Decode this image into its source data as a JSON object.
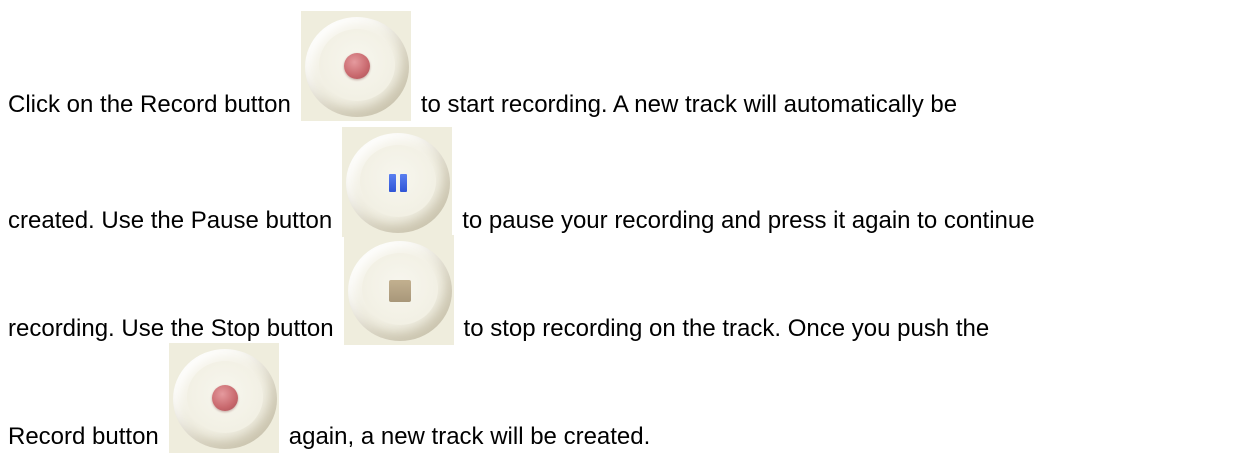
{
  "lines": [
    {
      "before": "Click on the Record button",
      "icon": "record-icon",
      "after": "to start recording. A new track will automatically be"
    },
    {
      "before": "created. Use the Pause button",
      "icon": "pause-icon",
      "after": "to pause your recording and press it again to continue"
    },
    {
      "before": "recording. Use the Stop button",
      "icon": "stop-icon",
      "after": " to stop recording on the track.  Once you push the"
    },
    {
      "before": "Record button",
      "icon": "record-icon",
      "after": "again, a new track will be created."
    }
  ],
  "colors": {
    "record": "#c8686d",
    "pause": "#2f55d6",
    "stop": "#b3a283",
    "button_face": "#efeddd"
  }
}
